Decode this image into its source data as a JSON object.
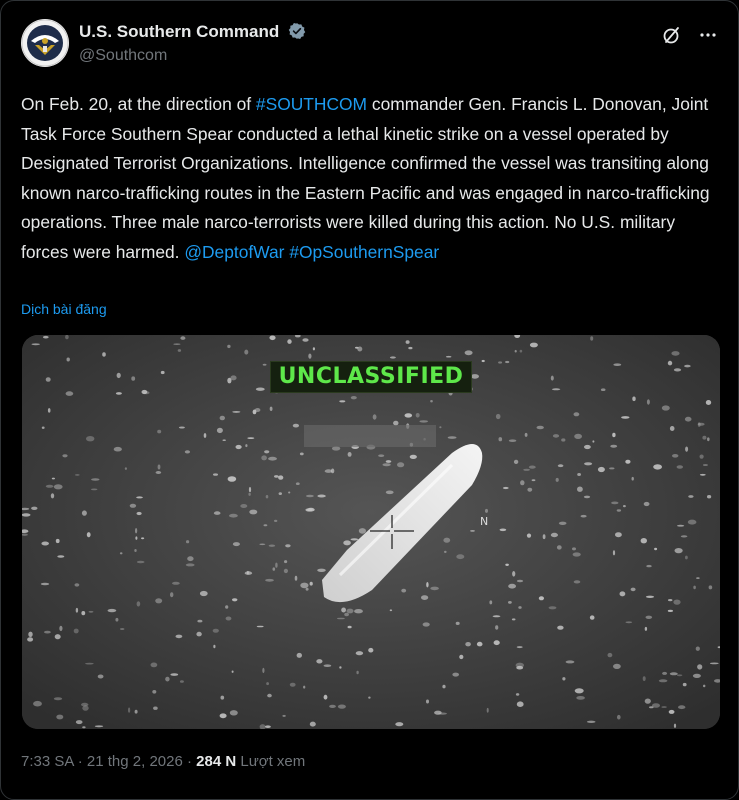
{
  "account": {
    "display_name": "U.S. Southern Command",
    "handle": "@Southcom",
    "avatar_icon": "southcom-seal-icon",
    "verified_icon": "verified-badge-icon"
  },
  "actions": {
    "grok_icon": "grok-icon",
    "more_icon": "more-options-icon",
    "more_label": "···"
  },
  "tweet": {
    "text_before_hashtag": "On Feb. 20, at the direction of ",
    "hashtag_southcom": "#SOUTHCOM",
    "text_after_hashtag": " commander Gen. Francis L. Donovan, Joint Task Force Southern Spear conducted a lethal kinetic strike on a vessel operated by Designated Terrorist Organizations. Intelligence confirmed the vessel was transiting along known narco-trafficking routes in the Eastern Pacific and was engaged in narco-trafficking operations. Three male narco-terrorists were killed during this action. No U.S. military forces were harmed. ",
    "mention": "@DeptofWar",
    "space": " ",
    "hashtag_op": "#OpSouthernSpear"
  },
  "translate_label": "Dịch bài đăng",
  "media": {
    "overlay_label": "UNCLASSIFIED",
    "description_icon": "thermal-vessel-image"
  },
  "meta": {
    "time": "7:33 SA",
    "separator": " · ",
    "date": "21 thg 2, 2026",
    "views_count": "284 N",
    "views_label": " Lượt xem"
  },
  "colors": {
    "background": "#000000",
    "text": "#e7e9ea",
    "secondary": "#71767b",
    "link": "#1d9bf0",
    "overlay_text": "#5ee84a"
  }
}
